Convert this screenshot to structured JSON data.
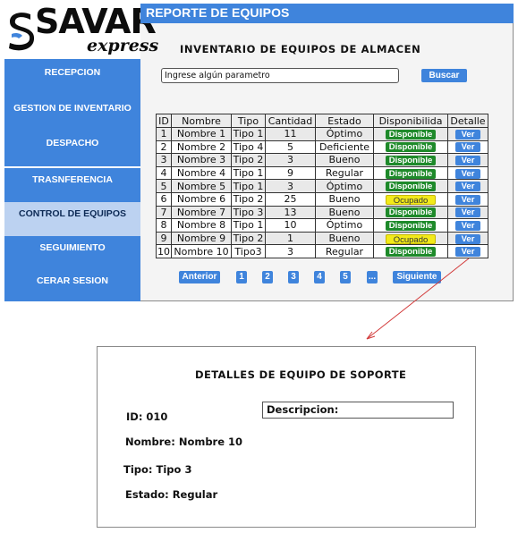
{
  "brand": {
    "name": "SAVAR",
    "tagline": "express"
  },
  "sidebar": {
    "items": [
      {
        "label": "RECEPCION",
        "active": false
      },
      {
        "label": "GESTION DE INVENTARIO",
        "active": false
      },
      {
        "label": "DESPACHO",
        "active": false
      },
      {
        "label": "TRASNFERENCIA",
        "active": false
      },
      {
        "label": "CONTROL DE EQUIPOS",
        "active": true
      },
      {
        "label": "SEGUIMIENTO",
        "active": false
      },
      {
        "label": "CERAR SESION",
        "active": false
      }
    ]
  },
  "header": {
    "title": "REPORTE DE EQUIPOS"
  },
  "main": {
    "section_title": "INVENTARIO DE EQUIPOS DE ALMACEN",
    "search": {
      "value": "Ingrese algún parametro",
      "button_label": "Buscar"
    },
    "table": {
      "columns": [
        "ID",
        "Nombre",
        "Tipo",
        "Cantidad",
        "Estado",
        "Disponibilida",
        "Detalle"
      ],
      "rows": [
        {
          "id": "1",
          "nombre": "Nombre 1",
          "tipo": "Tipo 1",
          "cantidad": "11",
          "estado": "Óptimo",
          "disponibilidad": "Disponible",
          "detalle": "Ver"
        },
        {
          "id": "2",
          "nombre": "Nombre 2",
          "tipo": "Tipo 4",
          "cantidad": "5",
          "estado": "Deficiente",
          "disponibilidad": "Disponible",
          "detalle": "Ver"
        },
        {
          "id": "3",
          "nombre": "Nombre 3",
          "tipo": "Tipo 2",
          "cantidad": "3",
          "estado": "Bueno",
          "disponibilidad": "Disponible",
          "detalle": "Ver"
        },
        {
          "id": "4",
          "nombre": "Nombre 4",
          "tipo": "Tipo 1",
          "cantidad": "9",
          "estado": "Regular",
          "disponibilidad": "Disponible",
          "detalle": "Ver"
        },
        {
          "id": "5",
          "nombre": "Nombre 5",
          "tipo": "Tipo 1",
          "cantidad": "3",
          "estado": "Óptimo",
          "disponibilidad": "Disponible",
          "detalle": "Ver"
        },
        {
          "id": "6",
          "nombre": "Nombre 6",
          "tipo": "Tipo 2",
          "cantidad": "25",
          "estado": "Bueno",
          "disponibilidad": "Ocupado",
          "detalle": "Ver"
        },
        {
          "id": "7",
          "nombre": "Nombre 7",
          "tipo": "Tipo 3",
          "cantidad": "13",
          "estado": "Bueno",
          "disponibilidad": "Disponible",
          "detalle": "Ver"
        },
        {
          "id": "8",
          "nombre": "Nombre 8",
          "tipo": "Tipo 1",
          "cantidad": "10",
          "estado": "Óptimo",
          "disponibilidad": "Disponible",
          "detalle": "Ver"
        },
        {
          "id": "9",
          "nombre": "Nombre 9",
          "tipo": "Tipo 2",
          "cantidad": "1",
          "estado": "Bueno",
          "disponibilidad": "Ocupado",
          "detalle": "Ver"
        },
        {
          "id": "10",
          "nombre": "Nombre 10",
          "tipo": "Tipo3",
          "cantidad": "3",
          "estado": "Regular",
          "disponibilidad": "Disponible",
          "detalle": "Ver"
        }
      ]
    },
    "pagination": {
      "prev_label": "Anterior",
      "pages": [
        "1",
        "2",
        "3",
        "4",
        "5"
      ],
      "ellipsis": "...",
      "next_label": "Siguiente"
    }
  },
  "detail": {
    "title": "DETALLES DE EQUIPO DE SOPORTE",
    "id_text": "ID: 010",
    "nombre_text": "Nombre: Nombre 10",
    "tipo_text": "Tipo: Tipo 3",
    "estado_text": "Estado: Regular",
    "descripcion_label": "Descripcion:"
  },
  "colors": {
    "accent_blue": "#3f84dc",
    "active_nav": "#bcd2f1",
    "available_green": "#1e8a2a",
    "occupied_yellow": "#f2ea1a",
    "connector_red": "#d23a3a"
  }
}
